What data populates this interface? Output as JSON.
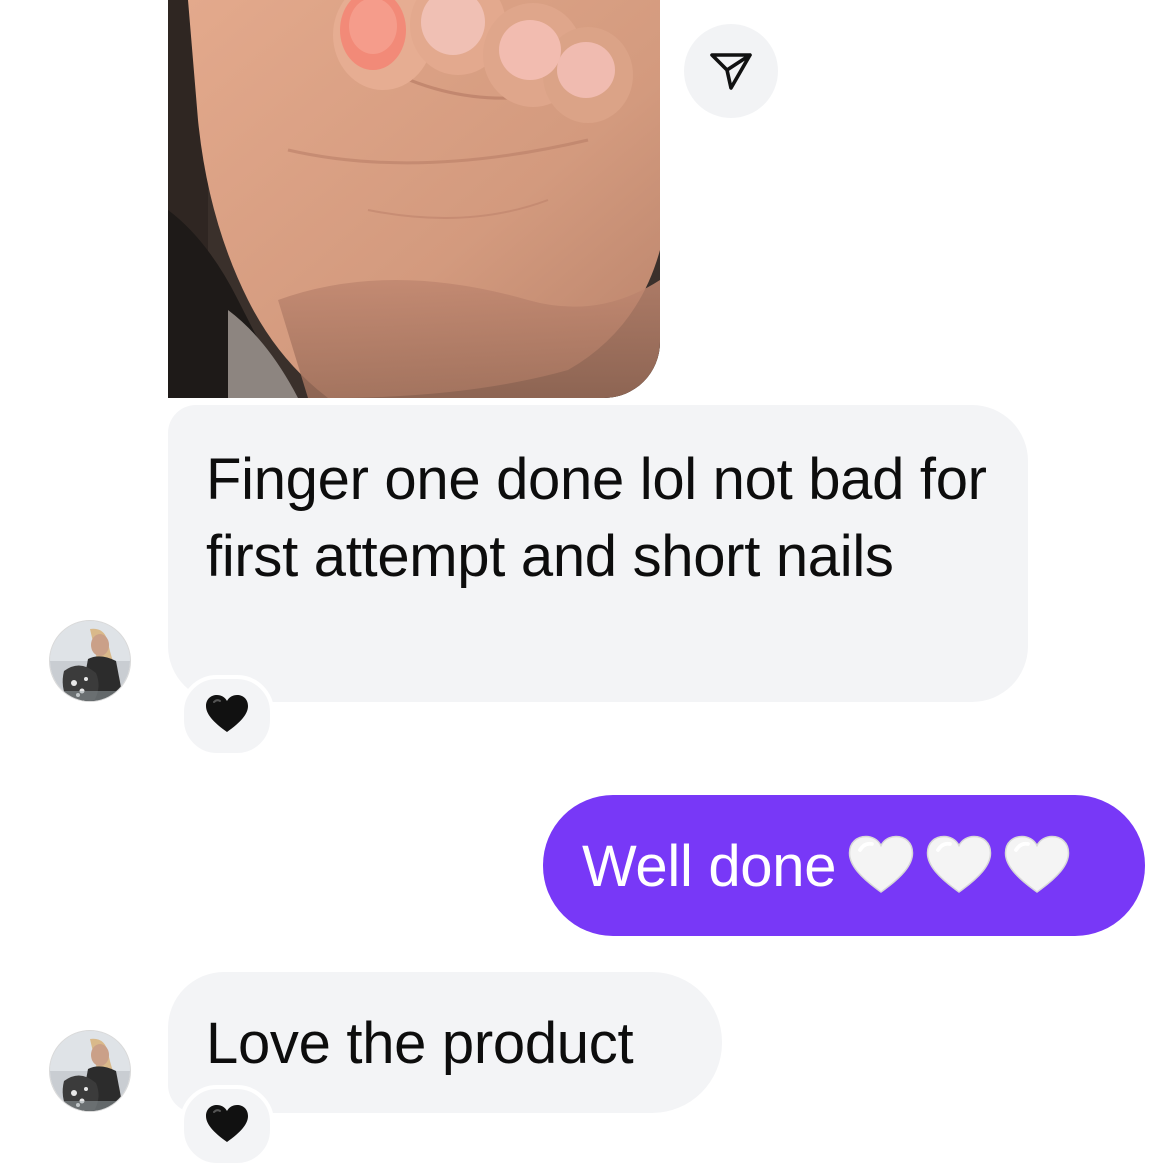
{
  "thread": {
    "shared_photo": {
      "description_icon": "shared-photo-hand-nails"
    },
    "share_action": {
      "icon": "paper-plane-icon"
    },
    "messages": [
      {
        "direction": "incoming",
        "text": "Finger one done lol not bad for first attempt and short nails",
        "reaction": "🖤"
      },
      {
        "direction": "outgoing",
        "text": "Well done",
        "emoji": [
          "🤍",
          "🤍",
          "🤍"
        ]
      },
      {
        "direction": "incoming",
        "text": "Love the product",
        "reaction": "🖤"
      }
    ]
  },
  "colors": {
    "incoming_bubble": "#f3f4f6",
    "outgoing_bubble": "#7838f7",
    "incoming_text": "#0d0d0d",
    "outgoing_text": "#ffffff"
  }
}
